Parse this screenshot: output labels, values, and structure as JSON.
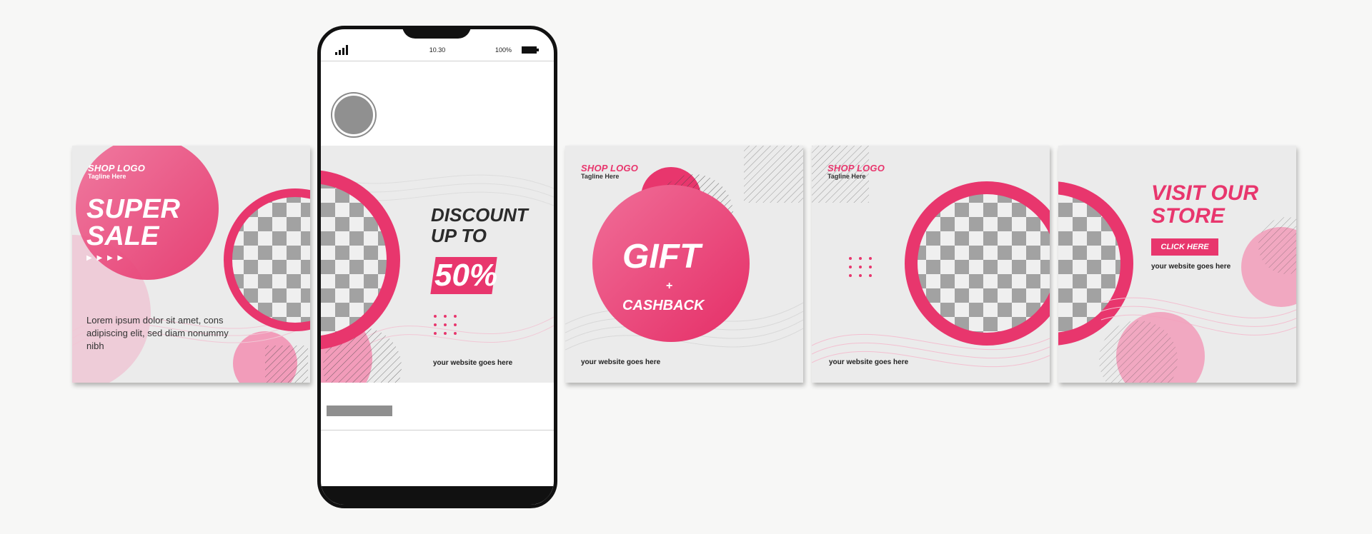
{
  "colors": {
    "accent": "#e8366d",
    "accent_light": "#f3a5be",
    "panel_bg": "#ebebeb",
    "checker_dark": "#a2a2a2",
    "checker_light": "#efefef"
  },
  "phone": {
    "time": "10.30",
    "battery": "100%",
    "signal_icon": "signal-bars-icon",
    "battery_icon": "battery-icon"
  },
  "panel1": {
    "logo": "SHOP LOGO",
    "tagline": "Tagline Here",
    "headline_1": "SUPER",
    "headline_2": "SALE",
    "arrows": "▶ ▶ ▶ ▶",
    "body_1": "Lorem ipsum dolor sit amet, cons",
    "body_2": "adipiscing elit, sed diam nonummy",
    "body_3": "nibh"
  },
  "panel2": {
    "line_1": "DISCOUNT",
    "line_2": "UP TO",
    "percent": "50%",
    "website": "your website goes here"
  },
  "panel3": {
    "logo": "SHOP LOGO",
    "tagline": "Tagline Here",
    "gift": "GIFT",
    "plus": "+",
    "cashback": "CASHBACK",
    "website": "your website goes here"
  },
  "panel4": {
    "logo": "SHOP LOGO",
    "tagline": "Tagline Here",
    "website": "your website goes here"
  },
  "panel5": {
    "line_1": "VISIT OUR",
    "line_2": "STORE",
    "button": "CLICK HERE",
    "website": "your website goes here"
  }
}
